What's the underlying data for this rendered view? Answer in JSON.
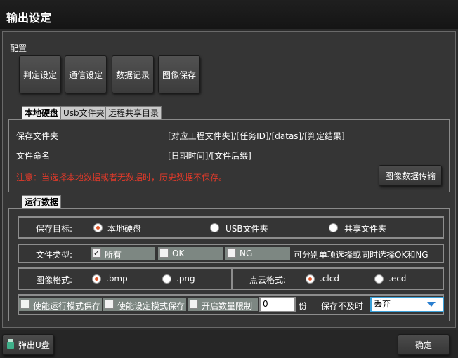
{
  "window": {
    "title": "输出设定"
  },
  "config": {
    "label": "配置",
    "buttons": [
      "判定设定",
      "通信设定",
      "数据记录",
      "图像保存"
    ]
  },
  "storage_tabs": [
    "本地硬盘",
    "Usb文件夹",
    "远程共享目录"
  ],
  "local": {
    "save_folder_label": "保存文件夹",
    "save_folder_value": "[对应工程文件夹]/[任务ID]/[datas]/[判定结果]",
    "file_naming_label": "文件命名",
    "file_naming_value": "[日期时间]/[文件后缀]",
    "warning": "注意：当选择本地数据或者无数据时，历史数据不保存。",
    "transfer_button": "图像数据传输"
  },
  "run_tab": "运行数据",
  "run": {
    "target_label": "保存目标:",
    "target_options": [
      "本地硬盘",
      "USB文件夹",
      "共享文件夹"
    ],
    "target_selected": "本地硬盘",
    "file_type_label": "文件类型:",
    "file_types": [
      "所有",
      "OK",
      "NG"
    ],
    "file_type_checked": "所有",
    "file_type_hint": "可分别单项选择或同时选择OK和NG",
    "image_format_label": "图像格式:",
    "image_formats": [
      ".bmp",
      ".png"
    ],
    "image_format_selected": ".bmp",
    "cloud_format_label": "点云格式:",
    "cloud_formats": [
      ".clcd",
      ".ecd"
    ],
    "cloud_format_selected": ".clcd",
    "enable_run_mode": "使能运行模式保存",
    "enable_setting_mode": "使能设定模式保存",
    "enable_count_limit": "开启数量限制",
    "count_value": "0",
    "count_unit": "份",
    "overflow_label": "保存不及时",
    "overflow_value": "丢弃"
  },
  "footer": {
    "eject_button": "弹出U盘",
    "ok_button": "确定"
  },
  "colors": {
    "warning": "#e23a2a",
    "radio_selected": "#e2572a",
    "select_border": "#3aa0d8"
  }
}
